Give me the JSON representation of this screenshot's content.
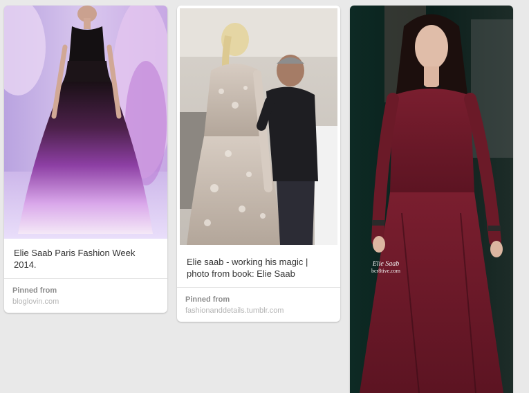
{
  "pins": [
    {
      "description": "Elie Saab Paris Fashion Week 2014.",
      "pinned_from_label": "Pinned from",
      "source": "bloglovin.com",
      "image": "runway gown with purple ombre skirt"
    },
    {
      "description": "Elie saab - working his magic | photo from book: Elie Saab",
      "pinned_from_label": "Pinned from",
      "source": "fashionanddetails.tumblr.com",
      "image": "designer fitting lace gown on model"
    },
    {
      "image": "model in burgundy long-sleeve gown",
      "watermark_line1": "Elie Saab",
      "watermark_line2": "bcr8tive.com"
    }
  ]
}
